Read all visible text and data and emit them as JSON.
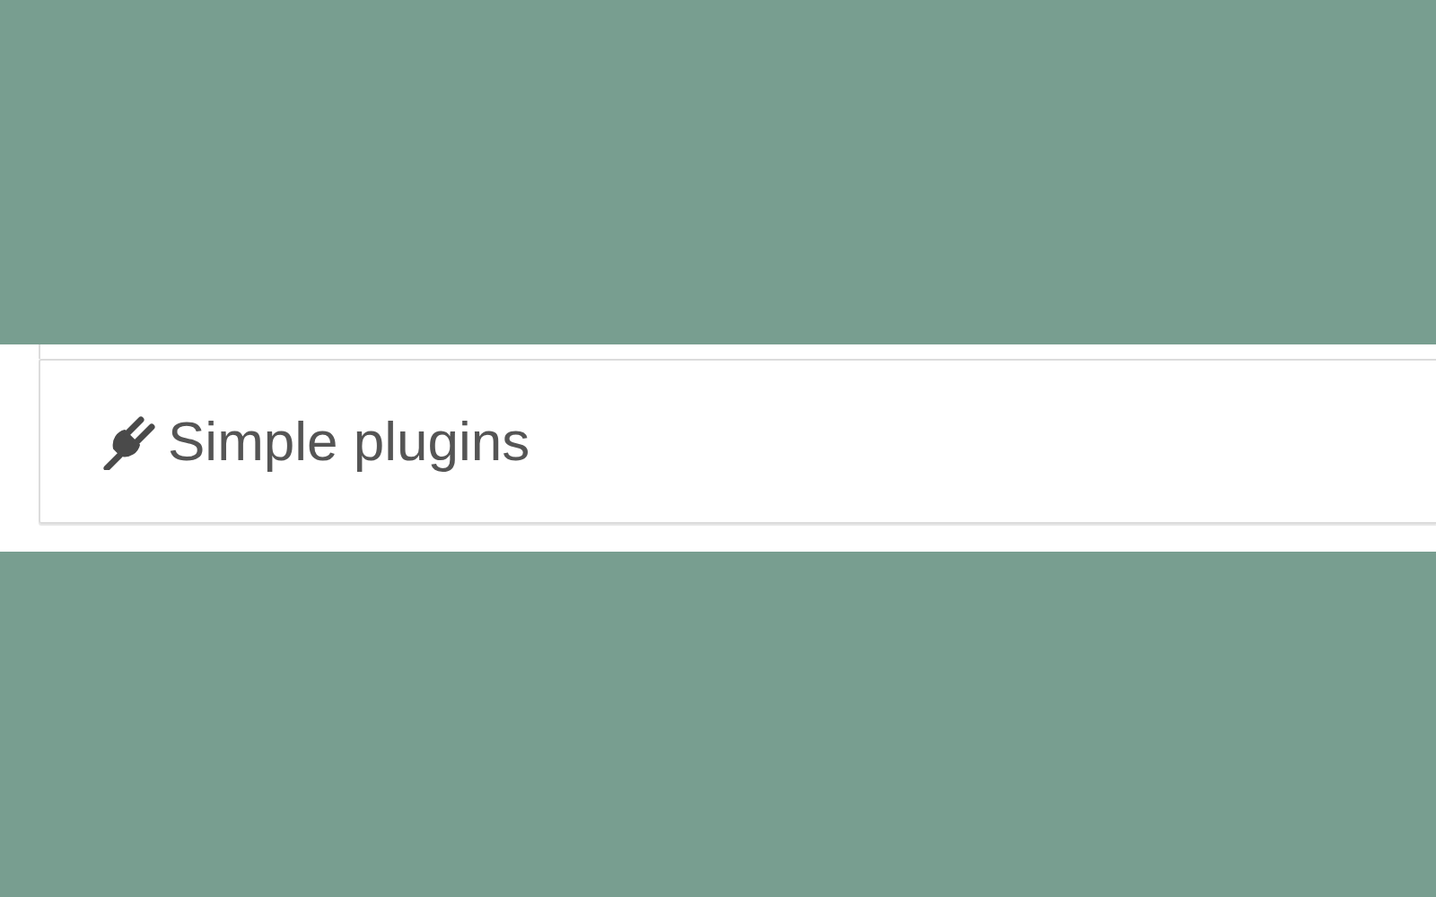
{
  "panel": {
    "title": "Simple plugins"
  }
}
